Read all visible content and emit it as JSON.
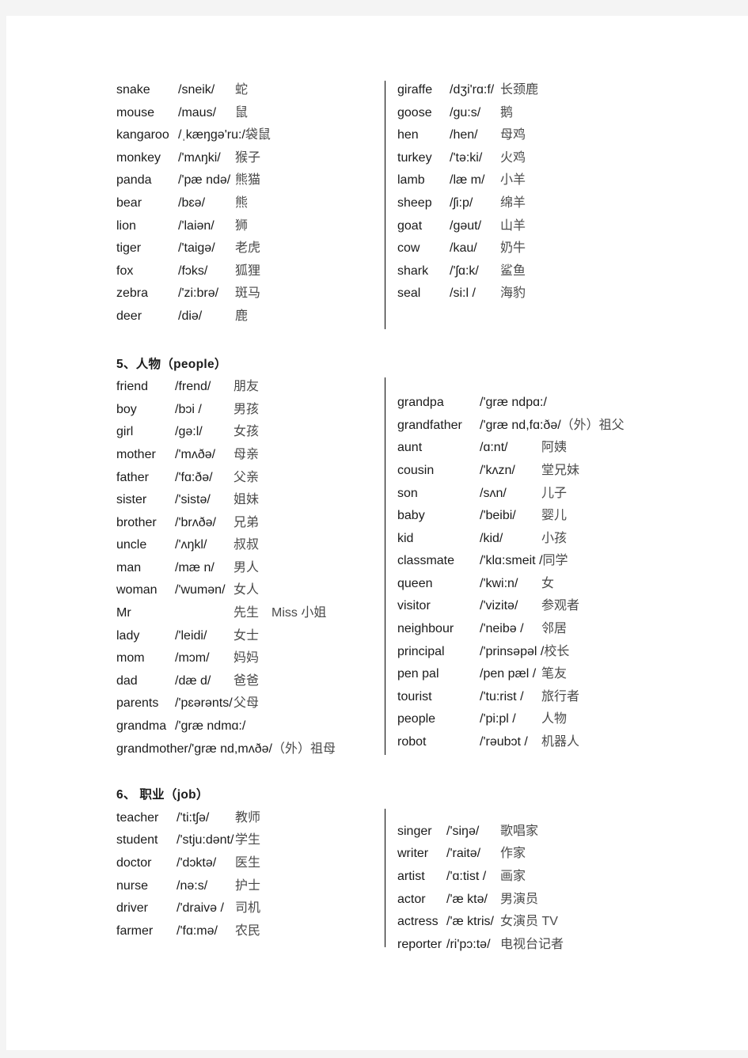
{
  "document": {
    "page_background": "#f4f4f4",
    "paper_background": "#ffffff",
    "text_color": "#1b1b1b",
    "chinese_color": "#4a4a4a"
  },
  "sections": [
    {
      "id": "animals-continued",
      "heading": "",
      "left_column": [
        {
          "word": "snake",
          "phonetic": "/sneik/",
          "chinese": "蛇"
        },
        {
          "word": "mouse",
          "phonetic": "/maus/",
          "chinese": "鼠"
        },
        {
          "word": "kangaroo",
          "phonetic": "/ˌkæŋgə'ru:/",
          "chinese": "袋鼠"
        },
        {
          "word": "monkey",
          "phonetic": "/'mʌŋki/",
          "chinese": "猴子"
        },
        {
          "word": "panda",
          "phonetic": "/'pæ ndə/",
          "chinese": "熊猫"
        },
        {
          "word": "bear",
          "phonetic": "/bɛə/",
          "chinese": "熊"
        },
        {
          "word": "lion",
          "phonetic": "/'laiən/",
          "chinese": "狮"
        },
        {
          "word": "tiger",
          "phonetic": "/'taigə/",
          "chinese": "老虎"
        },
        {
          "word": "fox",
          "phonetic": "/fɔks/",
          "chinese": "狐狸"
        },
        {
          "word": "zebra",
          "phonetic": "/'zi:brə/",
          "chinese": "斑马"
        },
        {
          "word": "deer",
          "phonetic": "/diə/",
          "chinese": "鹿"
        }
      ],
      "right_column": [
        {
          "word": "giraffe",
          "phonetic": "/dʒi'rɑ:f/",
          "chinese": "长颈鹿"
        },
        {
          "word": "goose",
          "phonetic": "/gu:s/",
          "chinese": "鹅"
        },
        {
          "word": "hen",
          "phonetic": "/hen/",
          "chinese": "母鸡"
        },
        {
          "word": "turkey",
          "phonetic": "/'tə:ki/",
          "chinese": "火鸡"
        },
        {
          "word": "lamb",
          "phonetic": "/læ m/",
          "chinese": "小羊"
        },
        {
          "word": "sheep",
          "phonetic": "/ʃi:p/",
          "chinese": "绵羊"
        },
        {
          "word": "goat",
          "phonetic": "/gəut/",
          "chinese": "山羊"
        },
        {
          "word": "cow",
          "phonetic": "/kau/",
          "chinese": "奶牛"
        },
        {
          "word": "shark",
          "phonetic": "/'ʃɑ:k/",
          "chinese": "鲨鱼"
        },
        {
          "word": "seal",
          "phonetic": "/si:l /",
          "chinese": "海豹"
        }
      ]
    },
    {
      "id": "people",
      "heading": "5、人物（people）",
      "left_column": [
        {
          "word": "friend",
          "phonetic": "/frend/",
          "chinese": "朋友"
        },
        {
          "word": "boy",
          "phonetic": "/bɔi /",
          "chinese": "男孩"
        },
        {
          "word": "girl",
          "phonetic": "/gə:l/",
          "chinese": "女孩"
        },
        {
          "word": "mother",
          "phonetic": "/'mʌðə/",
          "chinese": "母亲"
        },
        {
          "word": "father",
          "phonetic": "/'fɑ:ðə/",
          "chinese": "父亲"
        },
        {
          "word": "sister",
          "phonetic": "/'sistə/",
          "chinese": "姐妹"
        },
        {
          "word": "brother",
          "phonetic": "/'brʌðə/",
          "chinese": "兄弟"
        },
        {
          "word": "uncle",
          "phonetic": "/'ʌŋkl/",
          "chinese": "叔叔"
        },
        {
          "word": "man",
          "phonetic": "/mæ n/",
          "chinese": "男人"
        },
        {
          "word": "woman",
          "phonetic": "/'wumən/",
          "chinese": "女人"
        },
        {
          "word": "Mr",
          "phonetic": "",
          "chinese": "先生　Miss 小姐"
        },
        {
          "word": "lady",
          "phonetic": "/'leidi/",
          "chinese": "女士"
        },
        {
          "word": "mom",
          "phonetic": "/mɔm/",
          "chinese": "妈妈"
        },
        {
          "word": "dad",
          "phonetic": "/dæ d/",
          "chinese": "爸爸"
        },
        {
          "word": "parents",
          "phonetic": "/'pɛərənts/",
          "chinese": "父母"
        },
        {
          "word": "grandma",
          "phonetic": "/'græ ndmɑ:/",
          "chinese": ""
        },
        {
          "word": "grandmother",
          "phonetic": "/'græ nd,mʌðə/",
          "chinese": "（外）祖母"
        }
      ],
      "right_column": [
        {
          "word": "grandpa",
          "phonetic": "/'græ ndpɑ:/",
          "chinese": ""
        },
        {
          "word": "grandfather",
          "phonetic": "/'græ nd,fɑ:ðə/",
          "chinese": "（外）祖父"
        },
        {
          "word": "aunt",
          "phonetic": "/ɑ:nt/",
          "chinese": "阿姨"
        },
        {
          "word": "cousin",
          "phonetic": "/'kʌzn/",
          "chinese": "堂兄妹"
        },
        {
          "word": "son",
          "phonetic": "/sʌn/",
          "chinese": "儿子"
        },
        {
          "word": "baby",
          "phonetic": "/'beibi/",
          "chinese": "婴儿"
        },
        {
          "word": "kid",
          "phonetic": "/kid/",
          "chinese": "小孩"
        },
        {
          "word": "classmate",
          "phonetic": "/'klɑ:smeit /",
          "chinese": "同学"
        },
        {
          "word": "queen",
          "phonetic": "/'kwi:n/",
          "chinese": "女"
        },
        {
          "word": "visitor",
          "phonetic": "/'vizitə/",
          "chinese": "参观者"
        },
        {
          "word": "neighbour",
          "phonetic": "/'neibə /",
          "chinese": "邻居"
        },
        {
          "word": "principal",
          "phonetic": "/'prinsəpəl /",
          "chinese": "校长"
        },
        {
          "word": "pen pal",
          "phonetic": "/pen pæl /",
          "chinese": "笔友"
        },
        {
          "word": "tourist",
          "phonetic": "/'tu:rist /",
          "chinese": "旅行者"
        },
        {
          "word": "people",
          "phonetic": "/'pi:pl /",
          "chinese": "人物"
        },
        {
          "word": "robot",
          "phonetic": "/'rəubɔt /",
          "chinese": "机器人"
        }
      ]
    },
    {
      "id": "job",
      "heading": "6、  职业（job）",
      "left_column": [
        {
          "word": "teacher",
          "phonetic": "/'ti:tʃə/",
          "chinese": "教师"
        },
        {
          "word": "student",
          "phonetic": "/'stju:dənt/",
          "chinese": "学生"
        },
        {
          "word": "doctor",
          "phonetic": "/'dɔktə/",
          "chinese": "医生"
        },
        {
          "word": "nurse",
          "phonetic": "/nə:s/",
          "chinese": "护士"
        },
        {
          "word": "driver",
          "phonetic": "/'draivə /",
          "chinese": "司机"
        },
        {
          "word": "farmer",
          "phonetic": "/'fɑ:mə/",
          "chinese": "农民"
        }
      ],
      "right_column": [
        {
          "word": "singer",
          "phonetic": "/'siŋə/",
          "chinese": "歌唱家"
        },
        {
          "word": "writer",
          "phonetic": "/'raitə/",
          "chinese": "作家"
        },
        {
          "word": "artist",
          "phonetic": "/'ɑ:tist /",
          "chinese": "画家"
        },
        {
          "word": "actor",
          "phonetic": "/'æ ktə/",
          "chinese": "男演员"
        },
        {
          "word": "actress",
          "phonetic": "/'æ ktris/",
          "chinese": "女演员  TV"
        },
        {
          "word": "reporter",
          "phonetic": "/ri'pɔ:tə/",
          "chinese": "电视台记者"
        }
      ]
    }
  ]
}
